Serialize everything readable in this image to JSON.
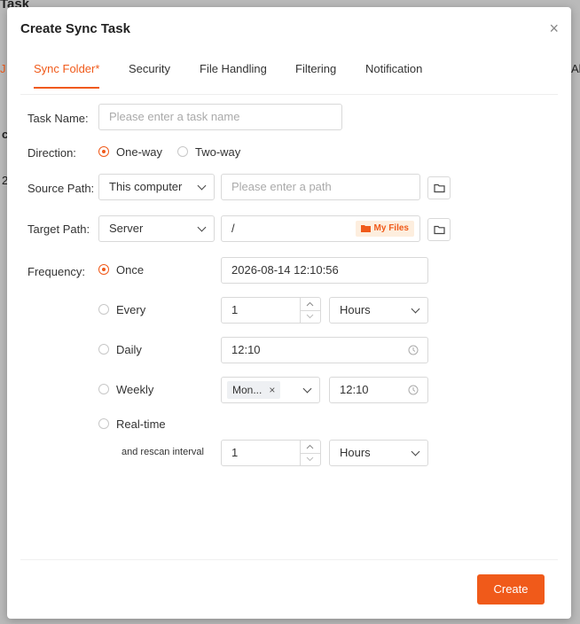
{
  "background": {
    "title_fragment": "Task",
    "left_fragment": "J",
    "row_fragment_c": "c",
    "row_fragment_2": "2",
    "right_fragment": "All"
  },
  "modal": {
    "title": "Create Sync Task",
    "close_symbol": "×",
    "tabs": [
      {
        "label": "Sync Folder",
        "required_mark": "*",
        "active": true
      },
      {
        "label": "Security"
      },
      {
        "label": "File Handling"
      },
      {
        "label": "Filtering"
      },
      {
        "label": "Notification"
      }
    ],
    "form": {
      "task_name": {
        "label": "Task Name:",
        "placeholder": "Please enter a task name"
      },
      "direction": {
        "label": "Direction:",
        "options": [
          "One-way",
          "Two-way"
        ],
        "selected": "One-way"
      },
      "source_path": {
        "label": "Source Path:",
        "location": "This computer",
        "placeholder": "Please enter a path"
      },
      "target_path": {
        "label": "Target Path:",
        "location": "Server",
        "value": "/",
        "badge": "My Files"
      },
      "frequency": {
        "label": "Frequency:",
        "selected": "Once",
        "once": {
          "label": "Once",
          "datetime": "2026-08-14 12:10:56"
        },
        "every": {
          "label": "Every",
          "value": "1",
          "unit": "Hours"
        },
        "daily": {
          "label": "Daily",
          "time": "12:10"
        },
        "weekly": {
          "label": "Weekly",
          "day_tag": "Mon...",
          "tag_close": "×",
          "time": "12:10"
        },
        "realtime": {
          "label": "Real-time",
          "rescan_label": "and rescan interval",
          "value": "1",
          "unit": "Hours"
        }
      }
    },
    "footer": {
      "create_label": "Create"
    }
  },
  "colors": {
    "accent": "#f05a1a",
    "border": "#d9d9d9",
    "placeholder": "#aaaaaa"
  }
}
